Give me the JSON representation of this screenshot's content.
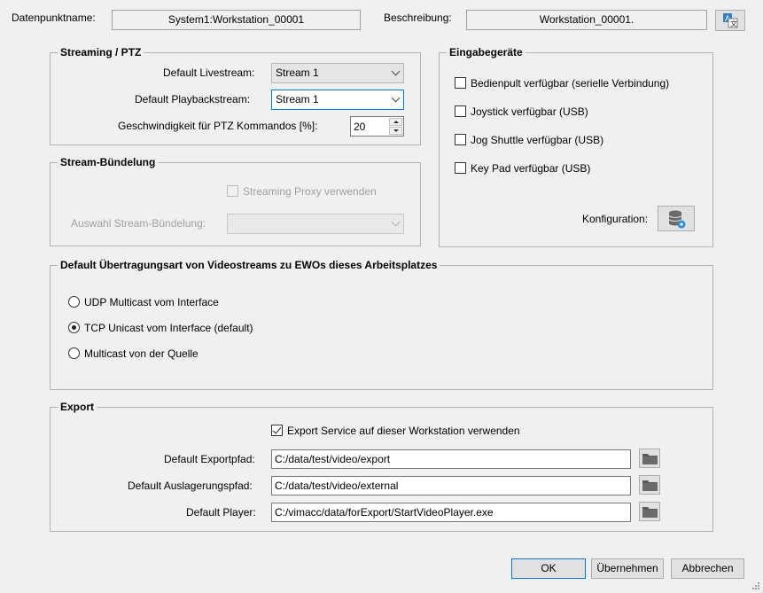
{
  "header": {
    "name_label": "Datenpunktname:",
    "name_value": "System1:Workstation_00001",
    "desc_label": "Beschreibung:",
    "desc_value": "Workstation_00001."
  },
  "streaming": {
    "title": "Streaming / PTZ",
    "live_label": "Default Livestream:",
    "live_value": "Stream 1",
    "playback_label": "Default Playbackstream:",
    "playback_value": "Stream 1",
    "ptz_label": "Geschwindigkeit für PTZ Kommandos [%]:",
    "ptz_value": "20"
  },
  "bundling": {
    "title": "Stream-Bündelung",
    "proxy_label": "Streaming Proxy verwenden",
    "select_label": "Auswahl Stream-Bündelung:",
    "select_value": ""
  },
  "input_devices": {
    "title": "Eingabegeräte",
    "items": [
      {
        "label": "Bedienpult verfügbar (serielle Verbindung)",
        "checked": false
      },
      {
        "label": "Joystick verfügbar (USB)",
        "checked": false
      },
      {
        "label": "Jog Shuttle verfügbar (USB)",
        "checked": false
      },
      {
        "label": "Key Pad verfügbar (USB)",
        "checked": false
      }
    ],
    "config_label": "Konfiguration:"
  },
  "transfer": {
    "title": "Default Übertragungsart von Videostreams zu EWOs dieses Arbeitsplatzes",
    "options": [
      {
        "label": "UDP Multicast vom Interface",
        "selected": false
      },
      {
        "label": "TCP Unicast vom Interface (default)",
        "selected": true
      },
      {
        "label": "Multicast von der Quelle",
        "selected": false
      }
    ]
  },
  "export": {
    "title": "Export",
    "service_label": "Export Service auf dieser Workstation verwenden",
    "service_checked": true,
    "export_path_label": "Default Exportpfad:",
    "export_path_value": "C:/data/test/video/export",
    "offload_path_label": "Default Auslagerungspfad:",
    "offload_path_value": "C:/data/test/video/external",
    "player_label": "Default Player:",
    "player_value": "C:/vimacc/data/forExport/StartVideoPlayer.exe"
  },
  "footer": {
    "ok_label": "OK",
    "apply_label": "Übernehmen",
    "cancel_label": "Abbrechen"
  },
  "colors": {
    "focus_border": "#0078d7",
    "folder": "#5a5a5a",
    "db_icon": "#6a6a6a",
    "db_badge": "#2f8fcf"
  }
}
